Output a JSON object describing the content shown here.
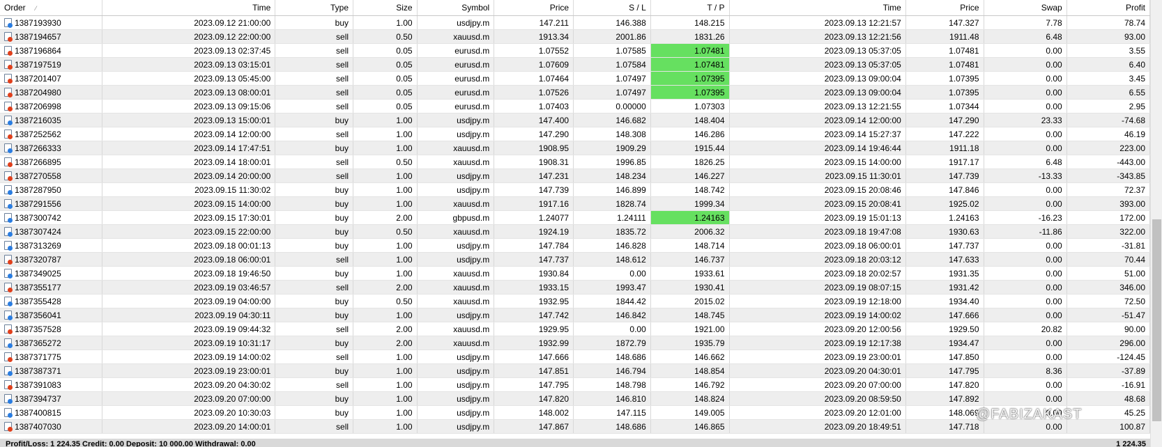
{
  "columns": [
    {
      "label": "Order",
      "align": "l"
    },
    {
      "label": "Time",
      "align": "r"
    },
    {
      "label": "Type",
      "align": "r"
    },
    {
      "label": "Size",
      "align": "r"
    },
    {
      "label": "Symbol",
      "align": "r"
    },
    {
      "label": "Price",
      "align": "r"
    },
    {
      "label": "S / L",
      "align": "r"
    },
    {
      "label": "T / P",
      "align": "r"
    },
    {
      "label": "Time",
      "align": "r"
    },
    {
      "label": "Price",
      "align": "r"
    },
    {
      "label": "Swap",
      "align": "r"
    },
    {
      "label": "Profit",
      "align": "r"
    }
  ],
  "sort_indicator": "⁄",
  "tp_highlight_color": "#66e060",
  "rows": [
    {
      "order": "1387193930",
      "open_time": "2023.09.12 21:00:00",
      "type": "buy",
      "size": "1.00",
      "symbol": "usdjpy.m",
      "price": "147.211",
      "sl": "146.388",
      "tp": "148.215",
      "tp_hit": false,
      "close_time": "2023.09.13 12:21:57",
      "close_price": "147.327",
      "swap": "7.78",
      "profit": "78.74"
    },
    {
      "order": "1387194657",
      "open_time": "2023.09.12 22:00:00",
      "type": "sell",
      "size": "0.50",
      "symbol": "xauusd.m",
      "price": "1913.34",
      "sl": "2001.86",
      "tp": "1831.26",
      "tp_hit": false,
      "close_time": "2023.09.13 12:21:56",
      "close_price": "1911.48",
      "swap": "6.48",
      "profit": "93.00"
    },
    {
      "order": "1387196864",
      "open_time": "2023.09.13 02:37:45",
      "type": "sell",
      "size": "0.05",
      "symbol": "eurusd.m",
      "price": "1.07552",
      "sl": "1.07585",
      "tp": "1.07481",
      "tp_hit": true,
      "close_time": "2023.09.13 05:37:05",
      "close_price": "1.07481",
      "swap": "0.00",
      "profit": "3.55"
    },
    {
      "order": "1387197519",
      "open_time": "2023.09.13 03:15:01",
      "type": "sell",
      "size": "0.05",
      "symbol": "eurusd.m",
      "price": "1.07609",
      "sl": "1.07584",
      "tp": "1.07481",
      "tp_hit": true,
      "close_time": "2023.09.13 05:37:05",
      "close_price": "1.07481",
      "swap": "0.00",
      "profit": "6.40"
    },
    {
      "order": "1387201407",
      "open_time": "2023.09.13 05:45:00",
      "type": "sell",
      "size": "0.05",
      "symbol": "eurusd.m",
      "price": "1.07464",
      "sl": "1.07497",
      "tp": "1.07395",
      "tp_hit": true,
      "close_time": "2023.09.13 09:00:04",
      "close_price": "1.07395",
      "swap": "0.00",
      "profit": "3.45"
    },
    {
      "order": "1387204980",
      "open_time": "2023.09.13 08:00:01",
      "type": "sell",
      "size": "0.05",
      "symbol": "eurusd.m",
      "price": "1.07526",
      "sl": "1.07497",
      "tp": "1.07395",
      "tp_hit": true,
      "close_time": "2023.09.13 09:00:04",
      "close_price": "1.07395",
      "swap": "0.00",
      "profit": "6.55"
    },
    {
      "order": "1387206998",
      "open_time": "2023.09.13 09:15:06",
      "type": "sell",
      "size": "0.05",
      "symbol": "eurusd.m",
      "price": "1.07403",
      "sl": "0.00000",
      "tp": "1.07303",
      "tp_hit": false,
      "close_time": "2023.09.13 12:21:55",
      "close_price": "1.07344",
      "swap": "0.00",
      "profit": "2.95"
    },
    {
      "order": "1387216035",
      "open_time": "2023.09.13 15:00:01",
      "type": "buy",
      "size": "1.00",
      "symbol": "usdjpy.m",
      "price": "147.400",
      "sl": "146.682",
      "tp": "148.404",
      "tp_hit": false,
      "close_time": "2023.09.14 12:00:00",
      "close_price": "147.290",
      "swap": "23.33",
      "profit": "-74.68"
    },
    {
      "order": "1387252562",
      "open_time": "2023.09.14 12:00:00",
      "type": "sell",
      "size": "1.00",
      "symbol": "usdjpy.m",
      "price": "147.290",
      "sl": "148.308",
      "tp": "146.286",
      "tp_hit": false,
      "close_time": "2023.09.14 15:27:37",
      "close_price": "147.222",
      "swap": "0.00",
      "profit": "46.19"
    },
    {
      "order": "1387266333",
      "open_time": "2023.09.14 17:47:51",
      "type": "buy",
      "size": "1.00",
      "symbol": "xauusd.m",
      "price": "1908.95",
      "sl": "1909.29",
      "tp": "1915.44",
      "tp_hit": false,
      "close_time": "2023.09.14 19:46:44",
      "close_price": "1911.18",
      "swap": "0.00",
      "profit": "223.00"
    },
    {
      "order": "1387266895",
      "open_time": "2023.09.14 18:00:01",
      "type": "sell",
      "size": "0.50",
      "symbol": "xauusd.m",
      "price": "1908.31",
      "sl": "1996.85",
      "tp": "1826.25",
      "tp_hit": false,
      "close_time": "2023.09.15 14:00:00",
      "close_price": "1917.17",
      "swap": "6.48",
      "profit": "-443.00"
    },
    {
      "order": "1387270558",
      "open_time": "2023.09.14 20:00:00",
      "type": "sell",
      "size": "1.00",
      "symbol": "usdjpy.m",
      "price": "147.231",
      "sl": "148.234",
      "tp": "146.227",
      "tp_hit": false,
      "close_time": "2023.09.15 11:30:01",
      "close_price": "147.739",
      "swap": "-13.33",
      "profit": "-343.85"
    },
    {
      "order": "1387287950",
      "open_time": "2023.09.15 11:30:02",
      "type": "buy",
      "size": "1.00",
      "symbol": "usdjpy.m",
      "price": "147.739",
      "sl": "146.899",
      "tp": "148.742",
      "tp_hit": false,
      "close_time": "2023.09.15 20:08:46",
      "close_price": "147.846",
      "swap": "0.00",
      "profit": "72.37"
    },
    {
      "order": "1387291556",
      "open_time": "2023.09.15 14:00:00",
      "type": "buy",
      "size": "1.00",
      "symbol": "xauusd.m",
      "price": "1917.16",
      "sl": "1828.74",
      "tp": "1999.34",
      "tp_hit": false,
      "close_time": "2023.09.15 20:08:41",
      "close_price": "1925.02",
      "swap": "0.00",
      "profit": "393.00"
    },
    {
      "order": "1387300742",
      "open_time": "2023.09.15 17:30:01",
      "type": "buy",
      "size": "2.00",
      "symbol": "gbpusd.m",
      "price": "1.24077",
      "sl": "1.24111",
      "tp": "1.24163",
      "tp_hit": true,
      "close_time": "2023.09.19 15:01:13",
      "close_price": "1.24163",
      "swap": "-16.23",
      "profit": "172.00"
    },
    {
      "order": "1387307424",
      "open_time": "2023.09.15 22:00:00",
      "type": "buy",
      "size": "0.50",
      "symbol": "xauusd.m",
      "price": "1924.19",
      "sl": "1835.72",
      "tp": "2006.32",
      "tp_hit": false,
      "close_time": "2023.09.18 19:47:08",
      "close_price": "1930.63",
      "swap": "-11.86",
      "profit": "322.00"
    },
    {
      "order": "1387313269",
      "open_time": "2023.09.18 00:01:13",
      "type": "buy",
      "size": "1.00",
      "symbol": "usdjpy.m",
      "price": "147.784",
      "sl": "146.828",
      "tp": "148.714",
      "tp_hit": false,
      "close_time": "2023.09.18 06:00:01",
      "close_price": "147.737",
      "swap": "0.00",
      "profit": "-31.81"
    },
    {
      "order": "1387320787",
      "open_time": "2023.09.18 06:00:01",
      "type": "sell",
      "size": "1.00",
      "symbol": "usdjpy.m",
      "price": "147.737",
      "sl": "148.612",
      "tp": "146.737",
      "tp_hit": false,
      "close_time": "2023.09.18 20:03:12",
      "close_price": "147.633",
      "swap": "0.00",
      "profit": "70.44"
    },
    {
      "order": "1387349025",
      "open_time": "2023.09.18 19:46:50",
      "type": "buy",
      "size": "1.00",
      "symbol": "xauusd.m",
      "price": "1930.84",
      "sl": "0.00",
      "tp": "1933.61",
      "tp_hit": false,
      "close_time": "2023.09.18 20:02:57",
      "close_price": "1931.35",
      "swap": "0.00",
      "profit": "51.00"
    },
    {
      "order": "1387355177",
      "open_time": "2023.09.19 03:46:57",
      "type": "sell",
      "size": "2.00",
      "symbol": "xauusd.m",
      "price": "1933.15",
      "sl": "1993.47",
      "tp": "1930.41",
      "tp_hit": false,
      "close_time": "2023.09.19 08:07:15",
      "close_price": "1931.42",
      "swap": "0.00",
      "profit": "346.00"
    },
    {
      "order": "1387355428",
      "open_time": "2023.09.19 04:00:00",
      "type": "buy",
      "size": "0.50",
      "symbol": "xauusd.m",
      "price": "1932.95",
      "sl": "1844.42",
      "tp": "2015.02",
      "tp_hit": false,
      "close_time": "2023.09.19 12:18:00",
      "close_price": "1934.40",
      "swap": "0.00",
      "profit": "72.50"
    },
    {
      "order": "1387356041",
      "open_time": "2023.09.19 04:30:11",
      "type": "buy",
      "size": "1.00",
      "symbol": "usdjpy.m",
      "price": "147.742",
      "sl": "146.842",
      "tp": "148.745",
      "tp_hit": false,
      "close_time": "2023.09.19 14:00:02",
      "close_price": "147.666",
      "swap": "0.00",
      "profit": "-51.47"
    },
    {
      "order": "1387357528",
      "open_time": "2023.09.19 09:44:32",
      "type": "sell",
      "size": "2.00",
      "symbol": "xauusd.m",
      "price": "1929.95",
      "sl": "0.00",
      "tp": "1921.00",
      "tp_hit": false,
      "close_time": "2023.09.20 12:00:56",
      "close_price": "1929.50",
      "swap": "20.82",
      "profit": "90.00"
    },
    {
      "order": "1387365272",
      "open_time": "2023.09.19 10:31:17",
      "type": "buy",
      "size": "2.00",
      "symbol": "xauusd.m",
      "price": "1932.99",
      "sl": "1872.79",
      "tp": "1935.79",
      "tp_hit": false,
      "close_time": "2023.09.19 12:17:38",
      "close_price": "1934.47",
      "swap": "0.00",
      "profit": "296.00"
    },
    {
      "order": "1387371775",
      "open_time": "2023.09.19 14:00:02",
      "type": "sell",
      "size": "1.00",
      "symbol": "usdjpy.m",
      "price": "147.666",
      "sl": "148.686",
      "tp": "146.662",
      "tp_hit": false,
      "close_time": "2023.09.19 23:00:01",
      "close_price": "147.850",
      "swap": "0.00",
      "profit": "-124.45"
    },
    {
      "order": "1387387371",
      "open_time": "2023.09.19 23:00:01",
      "type": "buy",
      "size": "1.00",
      "symbol": "usdjpy.m",
      "price": "147.851",
      "sl": "146.794",
      "tp": "148.854",
      "tp_hit": false,
      "close_time": "2023.09.20 04:30:01",
      "close_price": "147.795",
      "swap": "8.36",
      "profit": "-37.89"
    },
    {
      "order": "1387391083",
      "open_time": "2023.09.20 04:30:02",
      "type": "sell",
      "size": "1.00",
      "symbol": "usdjpy.m",
      "price": "147.795",
      "sl": "148.798",
      "tp": "146.792",
      "tp_hit": false,
      "close_time": "2023.09.20 07:00:00",
      "close_price": "147.820",
      "swap": "0.00",
      "profit": "-16.91"
    },
    {
      "order": "1387394737",
      "open_time": "2023.09.20 07:00:00",
      "type": "buy",
      "size": "1.00",
      "symbol": "usdjpy.m",
      "price": "147.820",
      "sl": "146.810",
      "tp": "148.824",
      "tp_hit": false,
      "close_time": "2023.09.20 08:59:50",
      "close_price": "147.892",
      "swap": "0.00",
      "profit": "48.68"
    },
    {
      "order": "1387400815",
      "open_time": "2023.09.20 10:30:03",
      "type": "buy",
      "size": "1.00",
      "symbol": "usdjpy.m",
      "price": "148.002",
      "sl": "147.115",
      "tp": "149.005",
      "tp_hit": false,
      "close_time": "2023.09.20 12:01:00",
      "close_price": "148.069",
      "swap": "0.00",
      "profit": "45.25"
    },
    {
      "order": "1387407030",
      "open_time": "2023.09.20 14:00:01",
      "type": "sell",
      "size": "1.00",
      "symbol": "usdjpy.m",
      "price": "147.867",
      "sl": "148.686",
      "tp": "146.865",
      "tp_hit": false,
      "close_time": "2023.09.20 18:49:51",
      "close_price": "147.718",
      "swap": "0.00",
      "profit": "100.87"
    }
  ],
  "footer": {
    "summary": "Profit/Loss: 1 224.35  Credit: 0.00  Deposit: 10 000.00  Withdrawal: 0.00",
    "total": "1 224.35"
  },
  "watermark": "@FABIZAKAST"
}
